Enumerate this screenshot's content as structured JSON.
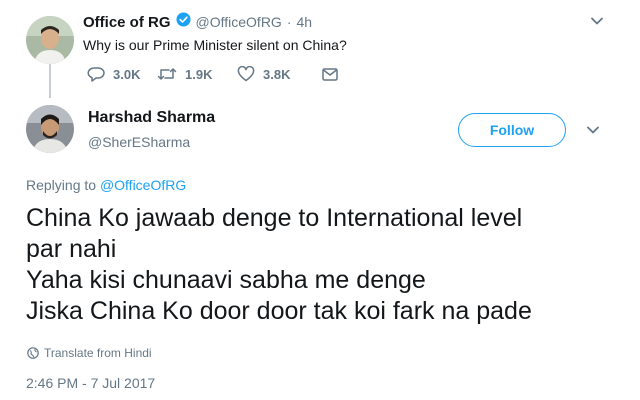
{
  "parent_tweet": {
    "name": "Office of RG",
    "handle": "@OfficeOfRG",
    "separator": "·",
    "time": "4h",
    "text": "Why is our Prime Minister silent on China?",
    "actions": {
      "replies": "3.0K",
      "retweets": "1.9K",
      "likes": "3.8K"
    }
  },
  "reply_tweet": {
    "name": "Harshad Sharma",
    "handle": "@SherESharma",
    "follow_label": "Follow",
    "replying_prefix": "Replying to",
    "replying_handle": "@OfficeOfRG",
    "lines": [
      "China Ko jawaab denge to International level",
      "par nahi",
      "Yaha kisi chunaavi sabha me denge",
      "Jiska China Ko door door tak koi fark na pade"
    ],
    "translate_label": "Translate from Hindi",
    "timestamp": "2:46 PM - 7 Jul 2017"
  },
  "colors": {
    "accent": "#1da1f2",
    "muted": "#657786",
    "text": "#14171a"
  },
  "icons": [
    "verified-badge-icon",
    "reply-icon",
    "retweet-icon",
    "like-icon",
    "message-icon",
    "chevron-down-icon",
    "globe-icon"
  ]
}
